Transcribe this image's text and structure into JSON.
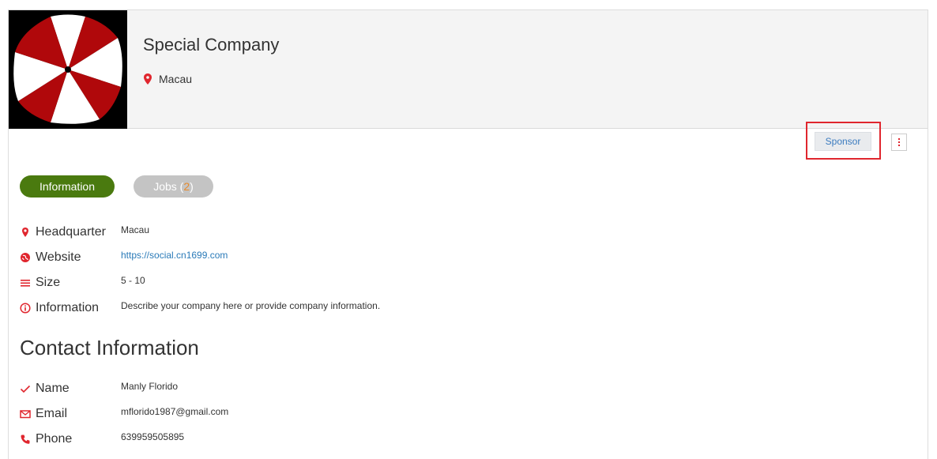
{
  "company": {
    "name": "Special Company",
    "location": "Macau"
  },
  "actions": {
    "sponsor_label": "Sponsor"
  },
  "tabs": [
    {
      "label": "Information",
      "active": true
    },
    {
      "label": "Jobs (",
      "count": "2",
      "suffix": ")",
      "active": false
    }
  ],
  "info": [
    {
      "icon": "location-pin-icon",
      "label": "Headquarter",
      "value": "Macau"
    },
    {
      "icon": "globe-icon",
      "label": "Website",
      "value": "https://social.cn1699.com"
    },
    {
      "icon": "list-lines-icon",
      "label": "Size",
      "value": "5 - 10"
    },
    {
      "icon": "info-circle-icon",
      "label": "Information",
      "value": "Describe your company here or provide company information."
    }
  ],
  "contact": {
    "title": "Contact Information",
    "items": [
      {
        "icon": "checkmark-icon",
        "label": "Name",
        "value": "Manly Florido"
      },
      {
        "icon": "envelope-icon",
        "label": "Email",
        "value": "mflorido1987@gmail.com"
      },
      {
        "icon": "phone-icon",
        "label": "Phone",
        "value": "639959505895"
      }
    ]
  },
  "colors": {
    "accent_red": "#e0262e",
    "active_tab": "#4a7a0f",
    "inactive_tab": "#c4c4c4",
    "link": "#2a7ab8",
    "jobs_count": "#e88a2c"
  }
}
